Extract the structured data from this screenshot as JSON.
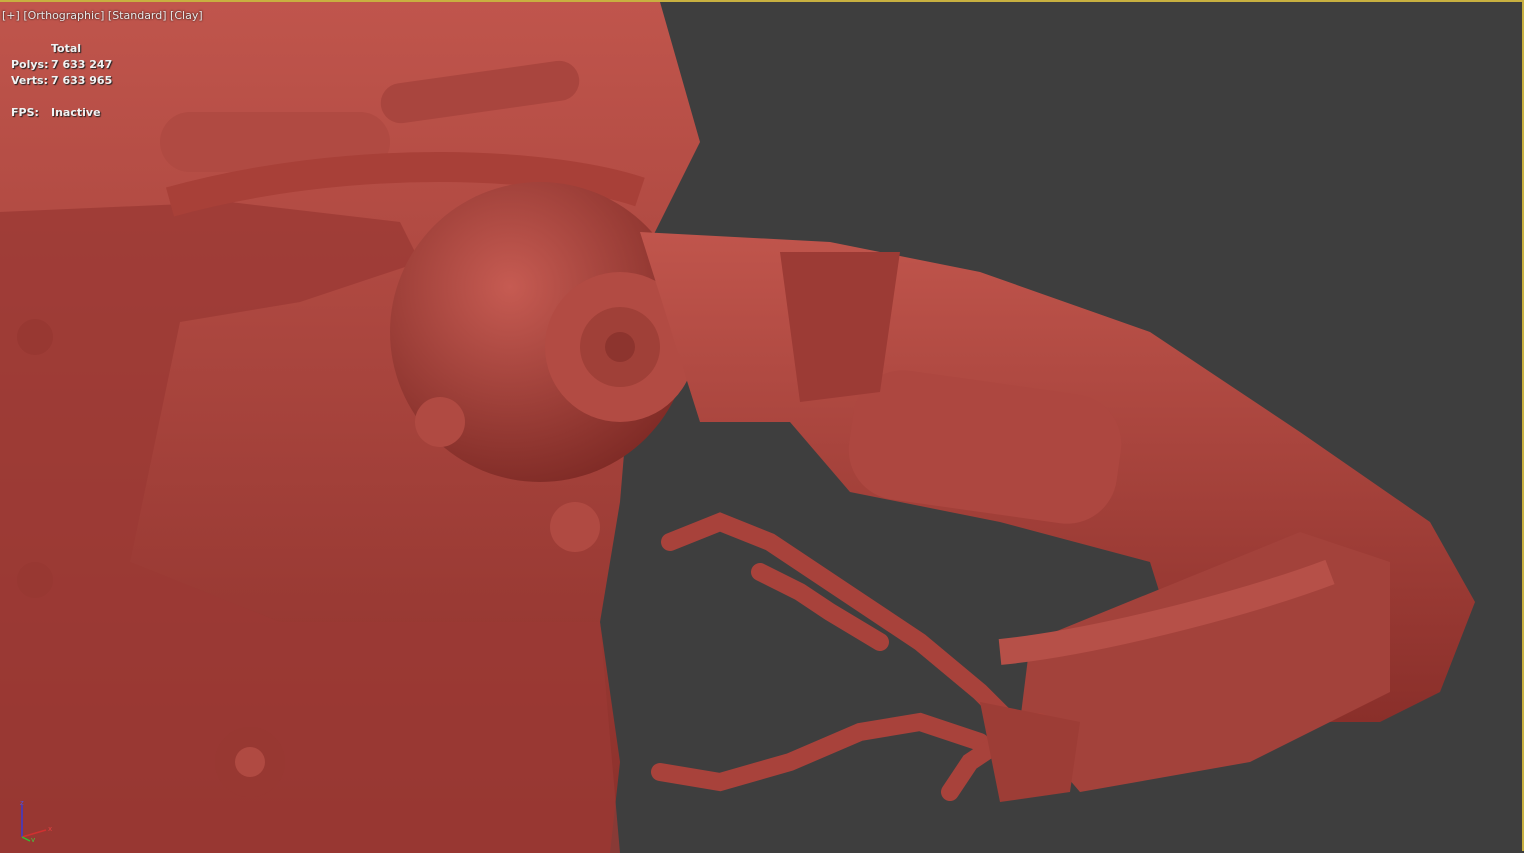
{
  "viewport": {
    "label": {
      "plus": "[+]",
      "view": "[Orthographic]",
      "shading": "[Standard]",
      "style": "[Clay]"
    },
    "stats": {
      "header": "Total",
      "polys_label": "Polys:",
      "polys": "7 633 247",
      "verts_label": "Verts:",
      "verts": "7 633 965",
      "fps_label": "FPS:",
      "fps": "Inactive"
    },
    "gizmo": {
      "z": "z",
      "x": "x",
      "y": "y"
    },
    "colors": {
      "background": "#3e3e3e",
      "clay": "#a8423b",
      "active_border": "#c8b040"
    }
  }
}
